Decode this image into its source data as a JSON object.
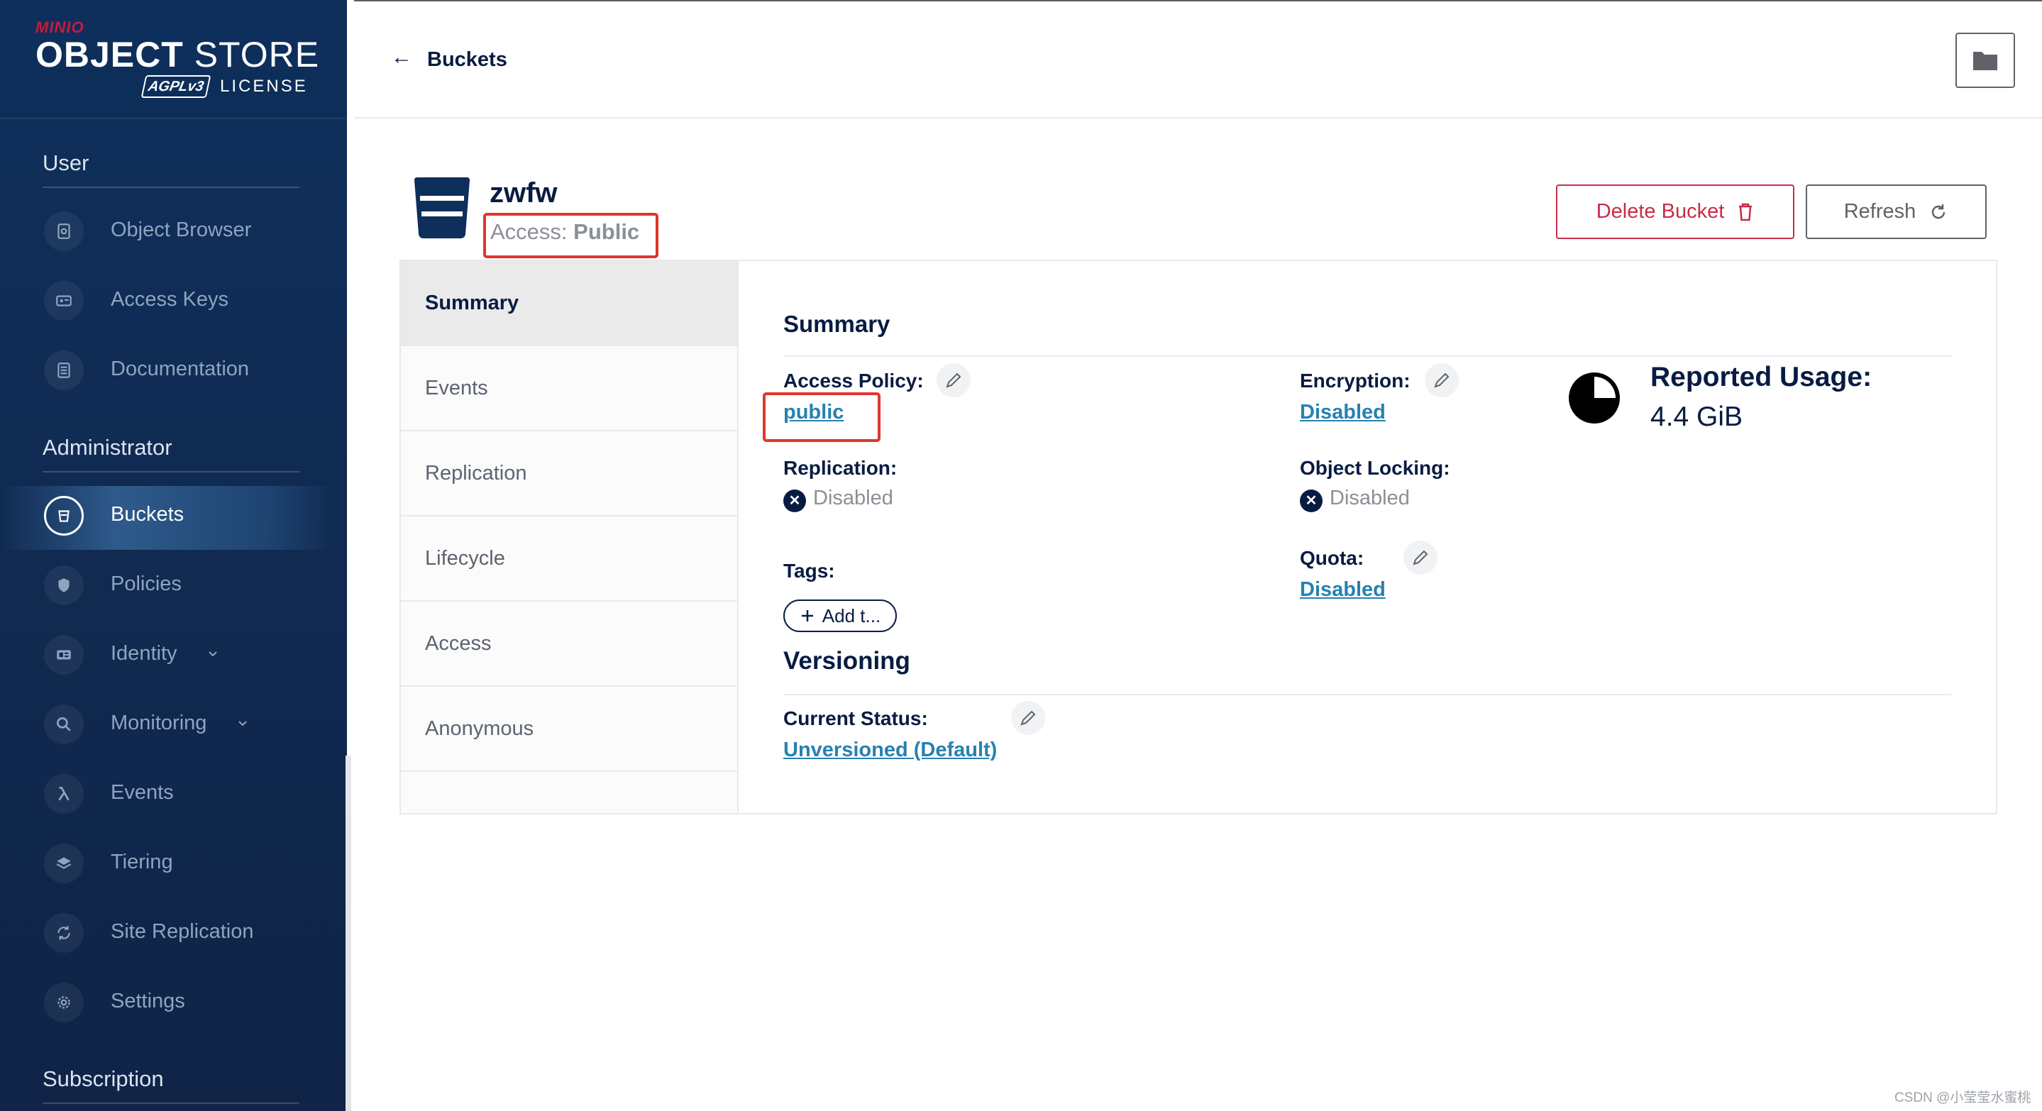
{
  "logo": {
    "brand": "MINIO",
    "product_bold": "OBJECT",
    "product_light": " STORE",
    "badge": "AGPLv3",
    "license": "LICENSE"
  },
  "sidebar": {
    "sections": [
      {
        "title": "User"
      },
      {
        "title": "Administrator"
      },
      {
        "title": "Subscription"
      }
    ],
    "user_items": [
      {
        "label": "Object Browser",
        "icon": "object-browser-icon"
      },
      {
        "label": "Access Keys",
        "icon": "access-keys-icon"
      },
      {
        "label": "Documentation",
        "icon": "documentation-icon"
      }
    ],
    "admin_items": [
      {
        "label": "Buckets",
        "icon": "bucket-icon",
        "active": true
      },
      {
        "label": "Policies",
        "icon": "shield-icon"
      },
      {
        "label": "Identity",
        "icon": "identity-icon",
        "expandable": true
      },
      {
        "label": "Monitoring",
        "icon": "magnifier-icon",
        "expandable": true
      },
      {
        "label": "Events",
        "icon": "lambda-icon"
      },
      {
        "label": "Tiering",
        "icon": "layers-icon"
      },
      {
        "label": "Site Replication",
        "icon": "sync-icon"
      },
      {
        "label": "Settings",
        "icon": "gear-icon"
      }
    ]
  },
  "topbar": {
    "back_label": "Buckets",
    "folder_icon": "folder-icon"
  },
  "bucket": {
    "name": "zwfw",
    "access_prefix": "Access: ",
    "access_value": "Public",
    "delete_label": "Delete Bucket",
    "refresh_label": "Refresh"
  },
  "tabs": [
    "Summary",
    "Events",
    "Replication",
    "Lifecycle",
    "Access",
    "Anonymous"
  ],
  "summary": {
    "heading": "Summary",
    "access_policy_label": "Access Policy:",
    "access_policy_value": "public",
    "encryption_label": "Encryption:",
    "encryption_value": "Disabled",
    "replication_label": "Replication:",
    "replication_value": "Disabled",
    "object_locking_label": "Object Locking:",
    "object_locking_value": "Disabled",
    "tags_label": "Tags:",
    "add_tag_label": "Add t...",
    "quota_label": "Quota:",
    "quota_value": "Disabled",
    "usage_label": "Reported Usage:",
    "usage_value": "4.4 GiB"
  },
  "versioning": {
    "heading": "Versioning",
    "status_label": "Current Status:",
    "status_value": "Unversioned (Default)"
  },
  "colors": {
    "sidebar": "#0e2f5c",
    "danger": "#c72c48",
    "link": "#2781b0",
    "highlight": "#e0362c",
    "text": "#081c42"
  },
  "watermark": "CSDN @小莹莹水蜜桃"
}
